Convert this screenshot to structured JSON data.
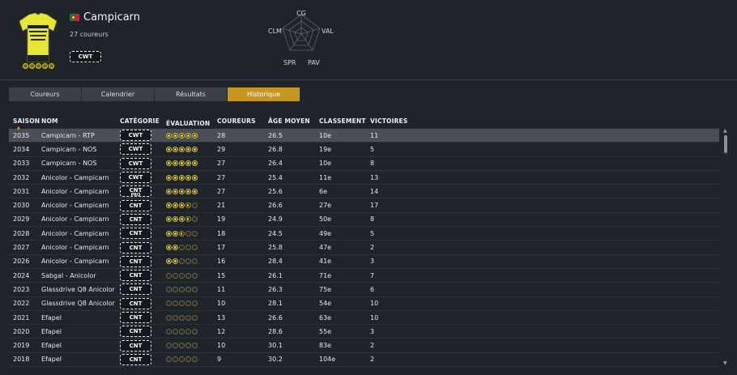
{
  "team": {
    "name": "Campicarn",
    "riders": "27 coureurs",
    "category": "CWT",
    "rating": 5,
    "country_colors": {
      "green": "#1c7a32",
      "red": "#d4202e"
    }
  },
  "radar": {
    "labels": {
      "cg": "CG",
      "val": "VAL",
      "pav": "PAV",
      "spr": "SPR",
      "clm": "CLM"
    }
  },
  "tabs": [
    {
      "label": "Coureurs",
      "active": false
    },
    {
      "label": "Calendrier",
      "active": false
    },
    {
      "label": "Résultats",
      "active": false
    },
    {
      "label": "Historique",
      "active": true
    }
  ],
  "table": {
    "headers": {
      "season": "SAISON",
      "name": "NOM",
      "category": "CATÉGORIE",
      "evaluation": "ÉVALUATION",
      "riders": "COUREURS",
      "age": "ÂGE MOYEN",
      "rank": "CLASSEMENT",
      "wins": "VICTOIRES"
    },
    "rows": [
      {
        "season": "2035",
        "name": "Campicarn - RTP",
        "category": "CWT",
        "rating": 5,
        "riders": "28",
        "age": "26.5",
        "rank": "10e",
        "wins": "11",
        "selected": true
      },
      {
        "season": "2034",
        "name": "Campicarn - NOS",
        "category": "CWT",
        "rating": 5,
        "riders": "29",
        "age": "26.8",
        "rank": "19e",
        "wins": "5"
      },
      {
        "season": "2033",
        "name": "Campicarn - NOS",
        "category": "CWT",
        "rating": 5,
        "riders": "27",
        "age": "26.4",
        "rank": "10e",
        "wins": "8"
      },
      {
        "season": "2032",
        "name": "Anicolor - Campicarn",
        "category": "CWT",
        "rating": 5,
        "riders": "27",
        "age": "25.4",
        "rank": "11e",
        "wins": "13"
      },
      {
        "season": "2031",
        "name": "Anicolor - Campicarn",
        "category": "CNT",
        "category_sub": "PRO",
        "rating": 5,
        "riders": "27",
        "age": "25.6",
        "rank": "6e",
        "wins": "14"
      },
      {
        "season": "2030",
        "name": "Anicolor - Campicarn",
        "category": "CNT",
        "rating": 3.5,
        "riders": "21",
        "age": "26.6",
        "rank": "27e",
        "wins": "17"
      },
      {
        "season": "2029",
        "name": "Anicolor - Campicarn",
        "category": "CNT",
        "rating": 3.5,
        "riders": "19",
        "age": "24.9",
        "rank": "50e",
        "wins": "8"
      },
      {
        "season": "2028",
        "name": "Anicolor - Campicarn",
        "category": "CNT",
        "rating": 2.5,
        "riders": "18",
        "age": "24.5",
        "rank": "49e",
        "wins": "5"
      },
      {
        "season": "2027",
        "name": "Anicolor - Campicarn",
        "category": "CNT",
        "rating": 2,
        "riders": "17",
        "age": "25.8",
        "rank": "47e",
        "wins": "2"
      },
      {
        "season": "2026",
        "name": "Anicolor - Campicarn",
        "category": "CNT",
        "rating": 2,
        "riders": "16",
        "age": "28.4",
        "rank": "41e",
        "wins": "3"
      },
      {
        "season": "2024",
        "name": "Sabgal - Anicolor",
        "category": "CNT",
        "rating": 0,
        "riders": "15",
        "age": "26.1",
        "rank": "71e",
        "wins": "7"
      },
      {
        "season": "2023",
        "name": "Glassdrive Q8 Anicolor",
        "category": "CNT",
        "rating": 0,
        "riders": "11",
        "age": "26.3",
        "rank": "75e",
        "wins": "6"
      },
      {
        "season": "2022",
        "name": "Glassdrive Q8 Anicolor",
        "category": "CNT",
        "rating": 0,
        "riders": "10",
        "age": "28.1",
        "rank": "54e",
        "wins": "10"
      },
      {
        "season": "2021",
        "name": "Efapel",
        "category": "CNT",
        "rating": 0,
        "riders": "13",
        "age": "26.6",
        "rank": "63e",
        "wins": "10"
      },
      {
        "season": "2020",
        "name": "Efapel",
        "category": "CNT",
        "rating": 0,
        "riders": "12",
        "age": "28.6",
        "rank": "55e",
        "wins": "3"
      },
      {
        "season": "2019",
        "name": "Efapel",
        "category": "CNT",
        "rating": 0,
        "riders": "10",
        "age": "30.1",
        "rank": "83e",
        "wins": "2"
      },
      {
        "season": "2018",
        "name": "Efapel",
        "category": "CNT",
        "rating": 0,
        "riders": "9",
        "age": "30.2",
        "rank": "104e",
        "wins": "2"
      }
    ]
  },
  "scroll": {
    "up": "▲",
    "down": "▼"
  },
  "sort_indicator": "▲"
}
